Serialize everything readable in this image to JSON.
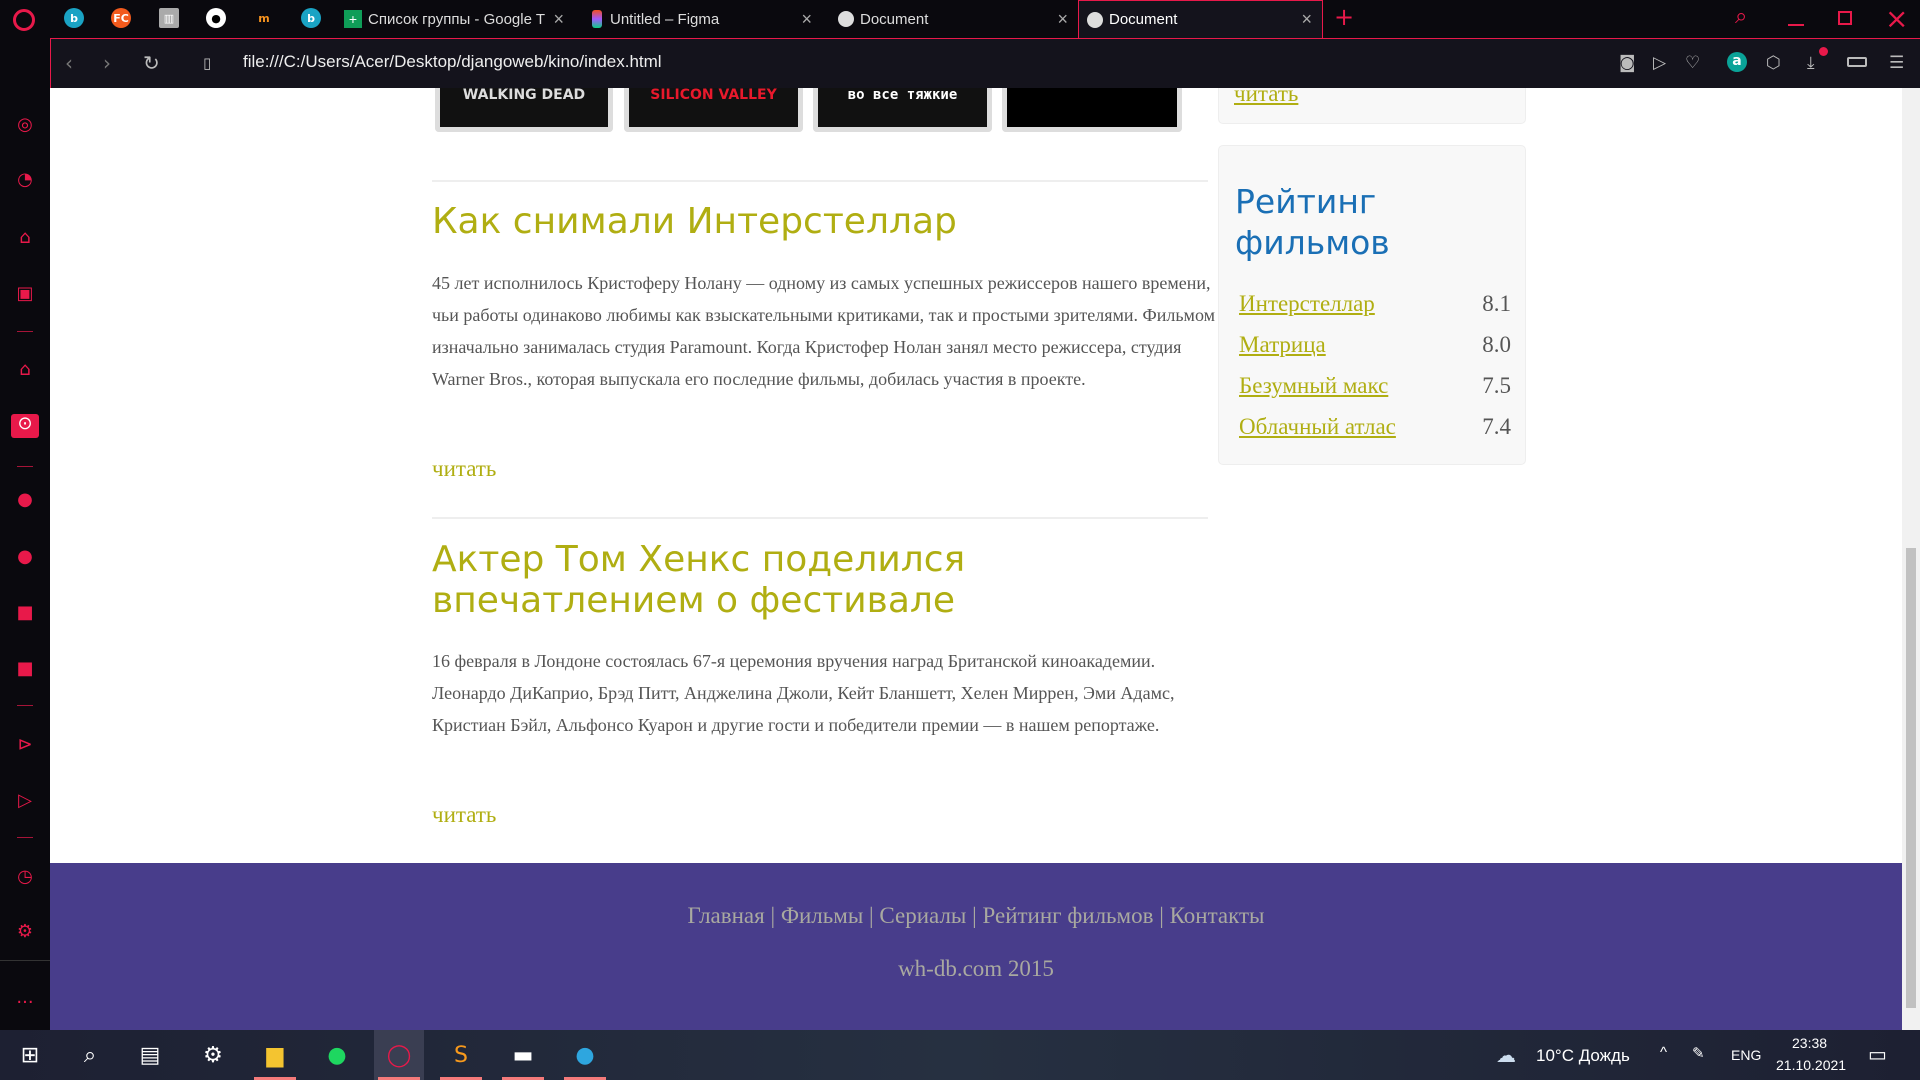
{
  "browser": {
    "tabs": [
      {
        "label": "Список группы - Google T",
        "icon": "google-sheets-icon"
      },
      {
        "label": "Untitled – Figma",
        "icon": "figma-icon"
      },
      {
        "label": "Document",
        "icon": "globe-icon"
      },
      {
        "label": "Document",
        "icon": "globe-icon",
        "active": true
      }
    ],
    "pinned": [
      "bing-icon",
      "fc-icon",
      "archive-icon",
      "github-icon",
      "moodle-icon",
      "bing-icon"
    ],
    "url": "file:///C:/Users/Acer/Desktop/djangoweb/kino/index.html",
    "accent": "#e8194a"
  },
  "page": {
    "posters": [
      "WALKING DEAD",
      "SILICON VALLEY",
      "во все тяжкие",
      ""
    ],
    "top_read_more": "читать",
    "articles": [
      {
        "title": "Как снимали Интерстеллар",
        "text": "45 лет исполнилось Кристоферу Нолану — одному из самых успешных режиссеров нашего времени, чьи работы одинаково любимы как взыскательными критиками, так и простыми зрителями. Фильмом изначально занималась студия Paramount. Когда Кристофер Нолан занял место режиссера, студия Warner Bros., которая выпускала его последние фильмы, добилась участия в проекте.",
        "more": "читать"
      },
      {
        "title": "Актер Том Хенкс поделился впечатлением о фестивале",
        "text": "16 февраля в Лондоне состоялась 67-я церемония вручения наград Британской киноакадемии. Леонардо ДиКаприо, Брэд Питт, Анджелина Джоли, Кейт Бланшетт, Хелен Миррен, Эми Адамс, Кристиан Бэйл, Альфонсо Куарон и другие гости и победители премии — в нашем репортаже.",
        "more": "читать"
      }
    ],
    "rating": {
      "title": "Рейтинг фильмов",
      "items": [
        {
          "name": "Интерстеллар",
          "score": "8.1"
        },
        {
          "name": "Матрица",
          "score": "8.0"
        },
        {
          "name": "Безумный макс",
          "score": "7.5"
        },
        {
          "name": "Облачный атлас",
          "score": "7.4"
        }
      ]
    },
    "footer": {
      "links": [
        "Главная",
        "Фильмы",
        "Сериалы",
        "Рейтинг фильмов",
        "Контакты"
      ],
      "copyright": "wh-db.com 2015"
    },
    "colors": {
      "heading": "#b0ae12",
      "rating_title": "#1a6fb5",
      "footer_bg": "#483d8b"
    }
  },
  "taskbar": {
    "weather": "10°C  Дождь",
    "lang": "ENG",
    "time": "23:38",
    "date": "21.10.2021"
  }
}
